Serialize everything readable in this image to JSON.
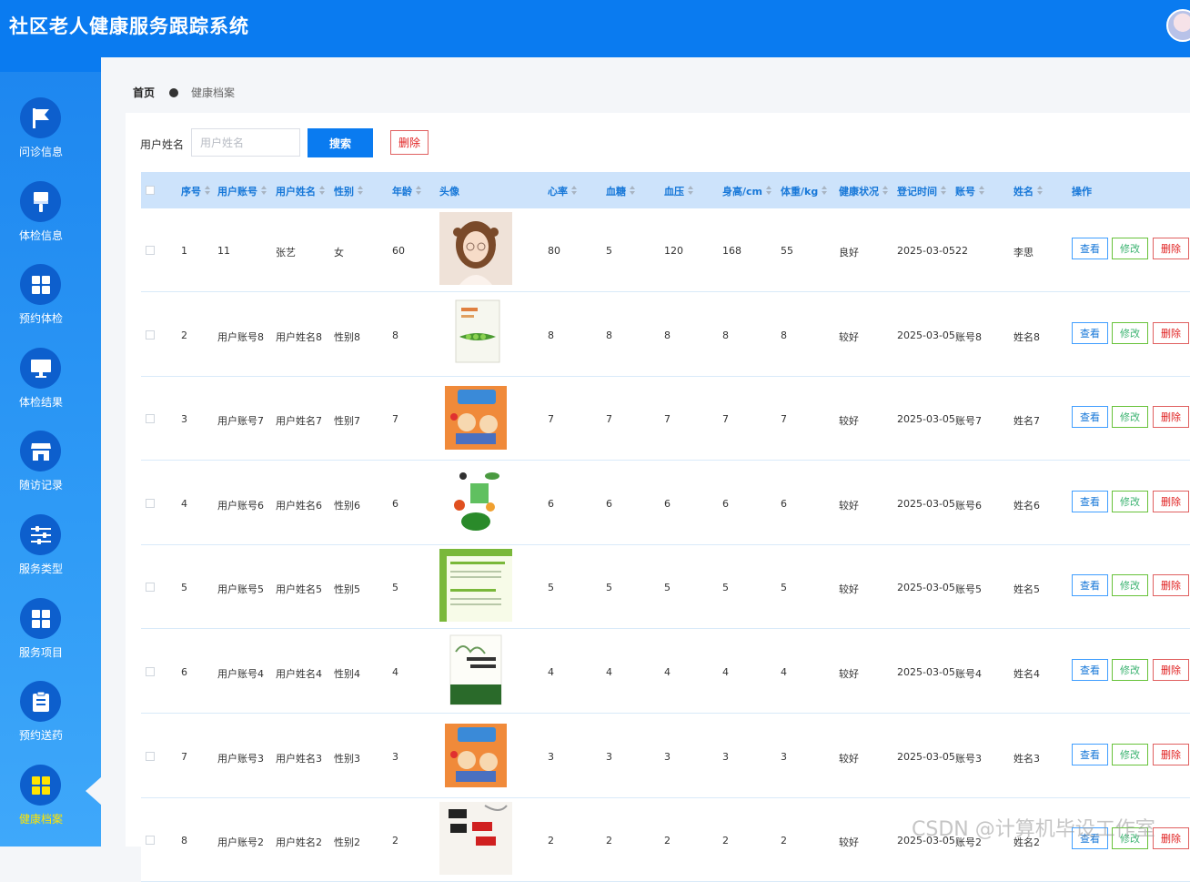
{
  "app": {
    "title": "社区老人健康服务跟踪系统"
  },
  "sidebar": {
    "items": [
      {
        "label": "问诊信息",
        "icon": "flag-icon",
        "active": false
      },
      {
        "label": "体检信息",
        "icon": "brush-icon",
        "active": false
      },
      {
        "label": "预约体检",
        "icon": "grid-icon",
        "active": false
      },
      {
        "label": "体检结果",
        "icon": "monitor-icon",
        "active": false
      },
      {
        "label": "随访记录",
        "icon": "shop-icon",
        "active": false
      },
      {
        "label": "服务类型",
        "icon": "sliders-icon",
        "active": false
      },
      {
        "label": "服务项目",
        "icon": "grid-icon",
        "active": false
      },
      {
        "label": "预约送药",
        "icon": "clipboard-icon",
        "active": false
      },
      {
        "label": "健康档案",
        "icon": "grid-icon",
        "active": true
      }
    ]
  },
  "breadcrumb": {
    "home": "首页",
    "current": "健康档案"
  },
  "search": {
    "label": "用户姓名",
    "placeholder": "用户姓名",
    "value": "",
    "search_button": "搜索",
    "delete_button": "删除"
  },
  "table": {
    "columns": [
      "序号",
      "用户账号",
      "用户姓名",
      "性别",
      "年龄",
      "头像",
      "心率",
      "血糖",
      "血压",
      "身高/cm",
      "体重/kg",
      "健康状况",
      "登记时间",
      "账号",
      "姓名",
      "操作"
    ],
    "actions": {
      "view": "查看",
      "edit": "修改",
      "delete": "删除"
    },
    "rows": [
      {
        "index": "1",
        "account": "11",
        "name": "张艺",
        "gender": "女",
        "age": "60",
        "heart_rate": "80",
        "blood_sugar": "5",
        "blood_pressure": "120",
        "height": "168",
        "weight": "55",
        "status": "良好",
        "date": "2025-03-05",
        "acct": "22",
        "real_name": "李思",
        "image": "girl-portrait"
      },
      {
        "index": "2",
        "account": "用户账号8",
        "name": "用户姓名8",
        "gender": "性别8",
        "age": "8",
        "heart_rate": "8",
        "blood_sugar": "8",
        "blood_pressure": "8",
        "height": "8",
        "weight": "8",
        "status": "较好",
        "date": "2025-03-05",
        "acct": "账号8",
        "real_name": "姓名8",
        "image": "book-green"
      },
      {
        "index": "3",
        "account": "用户账号7",
        "name": "用户姓名7",
        "gender": "性别7",
        "age": "7",
        "heart_rate": "7",
        "blood_sugar": "7",
        "blood_pressure": "7",
        "height": "7",
        "weight": "7",
        "status": "较好",
        "date": "2025-03-05",
        "acct": "账号7",
        "real_name": "姓名7",
        "image": "book-kids"
      },
      {
        "index": "4",
        "account": "用户账号6",
        "name": "用户姓名6",
        "gender": "性别6",
        "age": "6",
        "heart_rate": "6",
        "blood_sugar": "6",
        "blood_pressure": "6",
        "height": "6",
        "weight": "6",
        "status": "较好",
        "date": "2025-03-05",
        "acct": "账号6",
        "real_name": "姓名6",
        "image": "book-veg"
      },
      {
        "index": "5",
        "account": "用户账号5",
        "name": "用户姓名5",
        "gender": "性别5",
        "age": "5",
        "heart_rate": "5",
        "blood_sugar": "5",
        "blood_pressure": "5",
        "height": "5",
        "weight": "5",
        "status": "较好",
        "date": "2025-03-05",
        "acct": "账号5",
        "real_name": "姓名5",
        "image": "book-info"
      },
      {
        "index": "6",
        "account": "用户账号4",
        "name": "用户姓名4",
        "gender": "性别4",
        "age": "4",
        "heart_rate": "4",
        "blood_sugar": "4",
        "blood_pressure": "4",
        "height": "4",
        "weight": "4",
        "status": "较好",
        "date": "2025-03-05",
        "acct": "账号4",
        "real_name": "姓名4",
        "image": "book-health"
      },
      {
        "index": "7",
        "account": "用户账号3",
        "name": "用户姓名3",
        "gender": "性别3",
        "age": "3",
        "heart_rate": "3",
        "blood_sugar": "3",
        "blood_pressure": "3",
        "height": "3",
        "weight": "3",
        "status": "较好",
        "date": "2025-03-05",
        "acct": "账号3",
        "real_name": "姓名3",
        "image": "book-kids"
      },
      {
        "index": "8",
        "account": "用户账号2",
        "name": "用户姓名2",
        "gender": "性别2",
        "age": "2",
        "heart_rate": "2",
        "blood_sugar": "2",
        "blood_pressure": "2",
        "height": "2",
        "weight": "2",
        "status": "较好",
        "date": "2025-03-05",
        "acct": "账号2",
        "real_name": "姓名2",
        "image": "book-beauty"
      }
    ]
  },
  "watermark": "CSDN @计算机毕设工作室",
  "colors": {
    "primary": "#0a7bf0",
    "header_row": "#cde3fb",
    "active_menu": "#ffe500",
    "danger": "#e02020",
    "success": "#3cb371"
  }
}
